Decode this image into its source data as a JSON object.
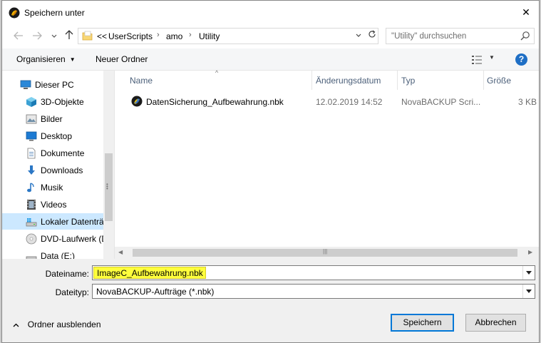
{
  "window": {
    "title": "Speichern unter",
    "close_label": "✕"
  },
  "address": {
    "overflow": "<<",
    "crumbs": [
      "UserScripts",
      "amo",
      "Utility"
    ],
    "search_placeholder": "\"Utility\" durchsuchen"
  },
  "toolbar": {
    "organize": "Organisieren",
    "new_folder": "Neuer Ordner",
    "help": "?"
  },
  "nav": {
    "items": [
      {
        "label": "Dieser PC",
        "icon": "pc-icon"
      },
      {
        "label": "3D-Objekte",
        "icon": "3d-objects-icon"
      },
      {
        "label": "Bilder",
        "icon": "pictures-icon"
      },
      {
        "label": "Desktop",
        "icon": "desktop-icon"
      },
      {
        "label": "Dokumente",
        "icon": "documents-icon"
      },
      {
        "label": "Downloads",
        "icon": "downloads-icon"
      },
      {
        "label": "Musik",
        "icon": "music-icon"
      },
      {
        "label": "Videos",
        "icon": "videos-icon"
      },
      {
        "label": "Lokaler Datenträger (C:)",
        "icon": "drive-icon"
      },
      {
        "label": "DVD-Laufwerk (D:)",
        "icon": "dvd-icon"
      },
      {
        "label": "Data (E:)",
        "icon": "drive-icon"
      }
    ]
  },
  "list": {
    "columns": {
      "name": "Name",
      "modified": "Änderungsdatum",
      "type": "Typ",
      "size": "Größe"
    },
    "files": [
      {
        "name": "DatenSicherung_Aufbewahrung.nbk",
        "modified": "12.02.2019 14:52",
        "type": "NovaBACKUP Scri...",
        "size": "3 KB"
      }
    ]
  },
  "form": {
    "filename_label": "Dateiname:",
    "filename_value": "ImageC_Aufbewahrung.nbk",
    "filetype_label": "Dateityp:",
    "filetype_value": "NovaBACKUP-Aufträge (*.nbk)"
  },
  "footer": {
    "hide_folders": "Ordner ausblenden",
    "save": "Speichern",
    "cancel": "Abbrechen"
  },
  "colors": {
    "accent": "#0078d7",
    "selection": "#cce8ff",
    "highlight": "#ffff3c"
  }
}
